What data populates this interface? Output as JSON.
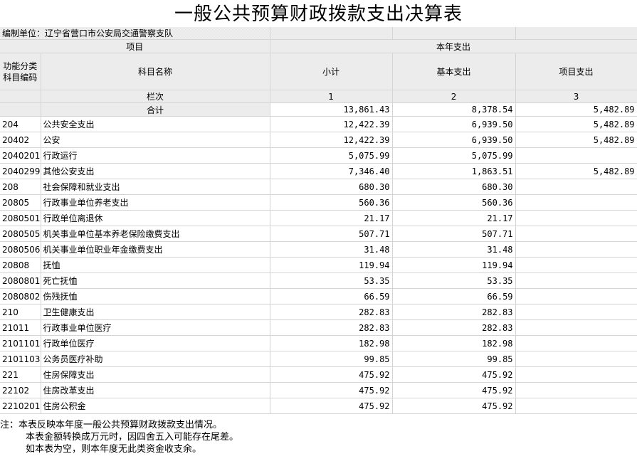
{
  "title": "一般公共预算财政拨款支出决算表",
  "unit_label": "编制单位：辽宁省营口市公安局交通警察支队",
  "header": {
    "project": "项目",
    "current_year": "本年支出",
    "func_code": "功能分类科目编码",
    "subject_name": "科目名称",
    "subtotal": "小计",
    "basic": "基本支出",
    "project_exp": "项目支出",
    "column_no": "栏次",
    "col1": "1",
    "col2": "2",
    "col3": "3",
    "total_label": "合计"
  },
  "totals": {
    "subtotal": "13,861.43",
    "basic": "8,378.54",
    "project": "5,482.89"
  },
  "rows": [
    {
      "code": "204",
      "name": "公共安全支出",
      "subtotal": "12,422.39",
      "basic": "6,939.50",
      "project": "5,482.89"
    },
    {
      "code": "20402",
      "name": "公安",
      "subtotal": "12,422.39",
      "basic": "6,939.50",
      "project": "5,482.89"
    },
    {
      "code": "2040201",
      "name": "行政运行",
      "subtotal": "5,075.99",
      "basic": "5,075.99",
      "project": ""
    },
    {
      "code": "2040299",
      "name": "其他公安支出",
      "subtotal": "7,346.40",
      "basic": "1,863.51",
      "project": "5,482.89"
    },
    {
      "code": "208",
      "name": "社会保障和就业支出",
      "subtotal": "680.30",
      "basic": "680.30",
      "project": ""
    },
    {
      "code": "20805",
      "name": "行政事业单位养老支出",
      "subtotal": "560.36",
      "basic": "560.36",
      "project": ""
    },
    {
      "code": "2080501",
      "name": "行政单位离退休",
      "subtotal": "21.17",
      "basic": "21.17",
      "project": ""
    },
    {
      "code": "2080505",
      "name": "机关事业单位基本养老保险缴费支出",
      "subtotal": "507.71",
      "basic": "507.71",
      "project": ""
    },
    {
      "code": "2080506",
      "name": "机关事业单位职业年金缴费支出",
      "subtotal": "31.48",
      "basic": "31.48",
      "project": ""
    },
    {
      "code": "20808",
      "name": "抚恤",
      "subtotal": "119.94",
      "basic": "119.94",
      "project": ""
    },
    {
      "code": "2080801",
      "name": "死亡抚恤",
      "subtotal": "53.35",
      "basic": "53.35",
      "project": ""
    },
    {
      "code": "2080802",
      "name": "伤残抚恤",
      "subtotal": "66.59",
      "basic": "66.59",
      "project": ""
    },
    {
      "code": "210",
      "name": "卫生健康支出",
      "subtotal": "282.83",
      "basic": "282.83",
      "project": ""
    },
    {
      "code": "21011",
      "name": "行政事业单位医疗",
      "subtotal": "282.83",
      "basic": "282.83",
      "project": ""
    },
    {
      "code": "2101101",
      "name": "行政单位医疗",
      "subtotal": "182.98",
      "basic": "182.98",
      "project": ""
    },
    {
      "code": "2101103",
      "name": "公务员医疗补助",
      "subtotal": "99.85",
      "basic": "99.85",
      "project": ""
    },
    {
      "code": "221",
      "name": "住房保障支出",
      "subtotal": "475.92",
      "basic": "475.92",
      "project": ""
    },
    {
      "code": "22102",
      "name": "住房改革支出",
      "subtotal": "475.92",
      "basic": "475.92",
      "project": ""
    },
    {
      "code": "2210201",
      "name": "住房公积金",
      "subtotal": "475.92",
      "basic": "475.92",
      "project": ""
    }
  ],
  "notes": [
    "注：本表反映本年度一般公共预算财政拨款支出情况。",
    "本表金额转换成万元时，因四舍五入可能存在尾差。",
    "如本表为空，则本年度无此类资金收支余。"
  ]
}
